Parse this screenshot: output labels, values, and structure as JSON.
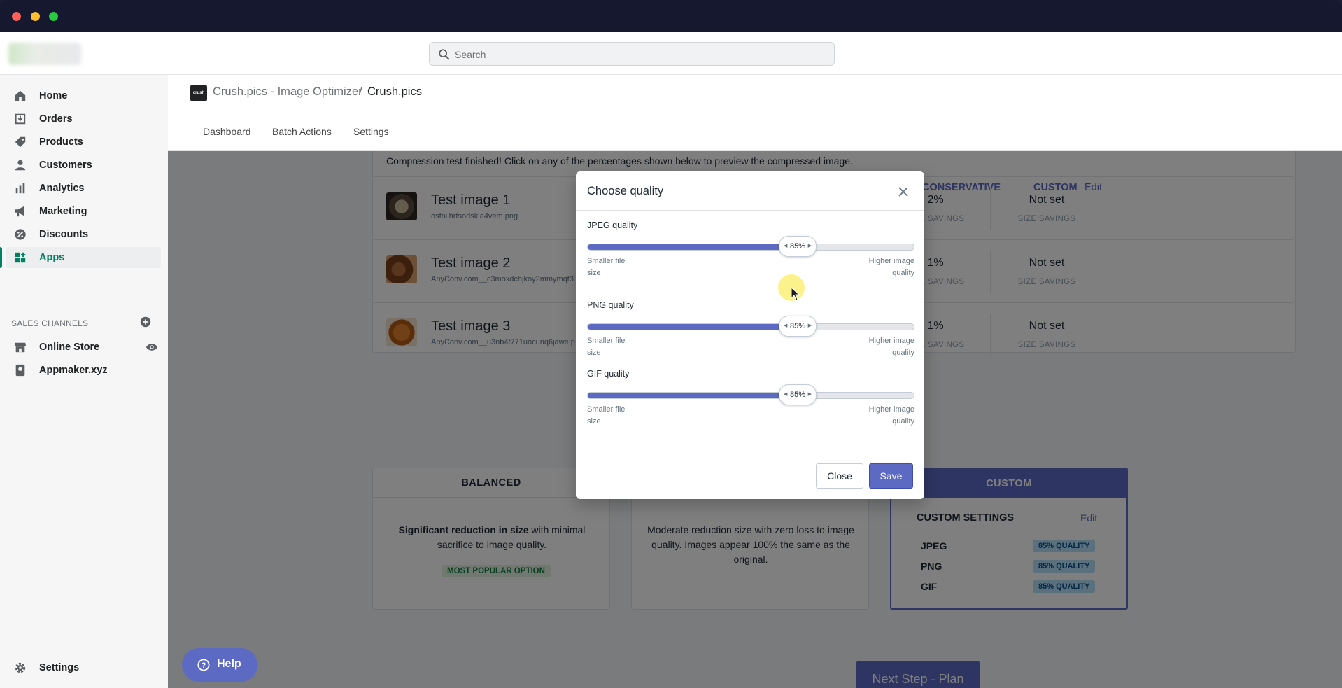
{
  "search": {
    "placeholder": "Search"
  },
  "sidebar": {
    "items": [
      {
        "label": "Home",
        "icon": "home-icon"
      },
      {
        "label": "Orders",
        "icon": "orders-icon"
      },
      {
        "label": "Products",
        "icon": "tag-icon"
      },
      {
        "label": "Customers",
        "icon": "person-icon"
      },
      {
        "label": "Analytics",
        "icon": "bar-chart-icon"
      },
      {
        "label": "Marketing",
        "icon": "megaphone-icon"
      },
      {
        "label": "Discounts",
        "icon": "discount-icon"
      },
      {
        "label": "Apps",
        "icon": "apps-icon",
        "active": true
      }
    ],
    "sales_channels_title": "SALES CHANNELS",
    "channels": [
      {
        "label": "Online Store",
        "icon": "store-icon"
      },
      {
        "label": "Appmaker.xyz",
        "icon": "app-icon"
      }
    ],
    "settings_label": "Settings"
  },
  "header": {
    "app_logo_text": "crush pics",
    "app_name": "Crush.pics - Image Optimizer",
    "separator": "/",
    "current": "Crush.pics"
  },
  "tabs": [
    "Dashboard",
    "Batch Actions",
    "Settings"
  ],
  "background": {
    "intro": "Compression test finished! Click on any of the percentages shown below to preview the compressed image.",
    "columns": {
      "conservative": "CONSERVATIVE",
      "custom": "CUSTOM",
      "edit": "Edit"
    },
    "size_savings_label": "SIZE SAVINGS",
    "tests": [
      {
        "name": "Test image 1",
        "file": "osfnilhrtsodskla4vem.png",
        "conservative": "2%",
        "custom": "Not set"
      },
      {
        "name": "Test image 2",
        "file": "AnyConv.com__c3moxdchjkoy2mmymqt3",
        "conservative": "1%",
        "custom": "Not set"
      },
      {
        "name": "Test image 3",
        "file": "AnyConv.com__u3nb4t771uocunq6jawe.p",
        "conservative": "1%",
        "custom": "Not set"
      }
    ],
    "balanced": {
      "title": "BALANCED",
      "desc_bold": "Significant reduction in size",
      "desc_rest": " with minimal sacrifice to image quality.",
      "badge": "MOST POPULAR OPTION"
    },
    "conservative_desc": "Moderate reduction size with zero loss to image quality. Images appear 100% the same as the original.",
    "custom": {
      "title": "CUSTOM",
      "settings_title": "CUSTOM SETTINGS",
      "edit": "Edit",
      "rows": [
        {
          "type": "JPEG",
          "quality": "85% QUALITY"
        },
        {
          "type": "PNG",
          "quality": "85% QUALITY"
        },
        {
          "type": "GIF",
          "quality": "85% QUALITY"
        }
      ]
    },
    "next_button": "Next Step - Plan",
    "help_button": "Help"
  },
  "modal": {
    "title": "Choose quality",
    "sliders": [
      {
        "label": "JPEG quality",
        "value": 85,
        "value_text": "85%"
      },
      {
        "label": "PNG quality",
        "value": 85,
        "value_text": "85%"
      },
      {
        "label": "GIF quality",
        "value": 85,
        "value_text": "85%"
      }
    ],
    "min_label_1": "Smaller file",
    "min_label_2": "size",
    "max_label_1": "Higher image",
    "max_label_2": "quality",
    "close_button": "Close",
    "save_button": "Save"
  },
  "colors": {
    "accent": "#5c6ac4",
    "active_nav": "#008060",
    "badge_green": "#108043"
  }
}
